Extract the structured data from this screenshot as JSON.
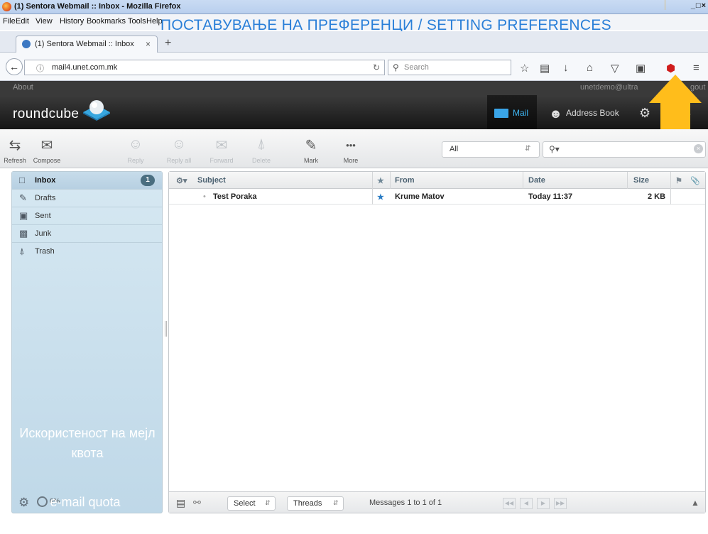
{
  "browser": {
    "window_title": "(1) Sentora Webmail :: Inbox - Mozilla Firefox",
    "window_buttons": "_□×",
    "menu": [
      "File",
      "Edit",
      "View",
      "History",
      "Bookmarks",
      "Tools",
      "Help"
    ],
    "tab_title": "(1) Sentora Webmail :: Inbox",
    "tab_close": "×",
    "new_tab": "+",
    "url": "mail4.unet.com.mk",
    "search_placeholder": "Search"
  },
  "annotation": {
    "title": "ПОСТАВУВАЊЕ НА ПРЕФЕРЕНЦИ / SETTING PREFERENCES",
    "quota_mk": "Искористеност на мејл квота",
    "quota_en": "e-mail quota usage",
    "accent_color": "#ffbd1b",
    "title_color": "#2a7fd8"
  },
  "rc": {
    "about": "About",
    "user": "unetdemo@ultra",
    "logout": "gout",
    "logo": "roundcube",
    "nav": {
      "mail": "Mail",
      "address_book": "Address Book",
      "settings": "gs"
    },
    "toolbar": {
      "refresh": "Refresh",
      "compose": "Compose",
      "reply": "Reply",
      "reply_all": "Reply all",
      "forward": "Forward",
      "delete": "Delete",
      "mark": "Mark",
      "more": "More"
    },
    "filter": "All",
    "folders": [
      {
        "label": "Inbox",
        "count": "1"
      },
      {
        "label": "Drafts"
      },
      {
        "label": "Sent"
      },
      {
        "label": "Junk"
      },
      {
        "label": "Trash"
      }
    ],
    "quota": "0%",
    "list": {
      "columns": {
        "subject": "Subject",
        "from": "From",
        "date": "Date",
        "size": "Size"
      },
      "rows": [
        {
          "subject": "Test Poraka",
          "from": "Krume Matov",
          "date": "Today 11:37",
          "size": "2 KB"
        }
      ],
      "footer": {
        "select": "Select",
        "threads": "Threads",
        "count": "Messages 1 to 1 of 1"
      }
    }
  }
}
